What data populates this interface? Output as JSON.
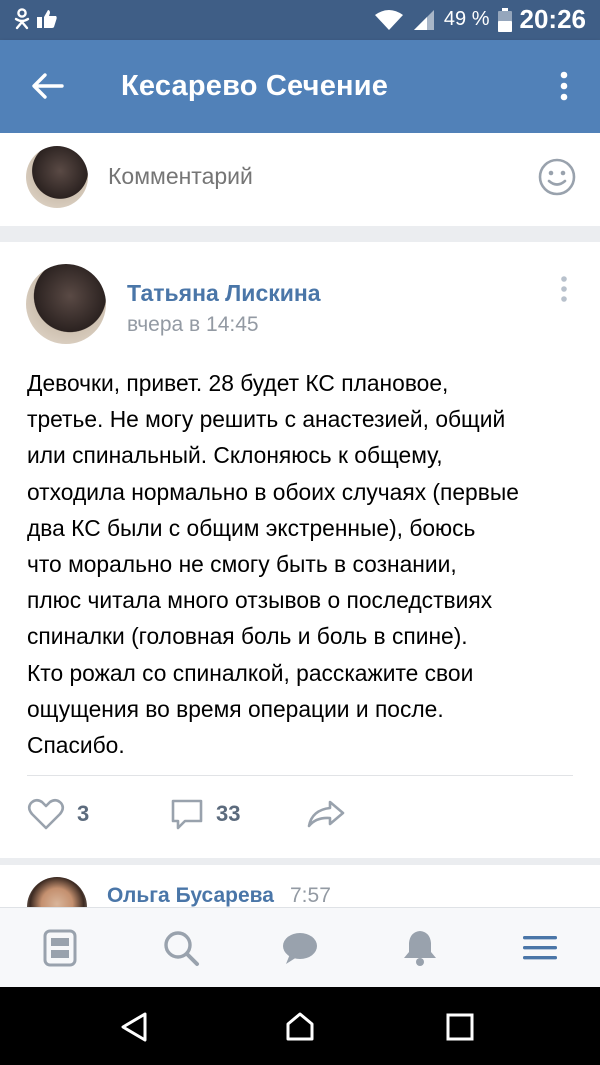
{
  "status_bar": {
    "left_icons": [
      "odnoklassniki-icon",
      "thumb-up-icon"
    ],
    "battery_percent": "49 %",
    "time": "20:26"
  },
  "app_bar": {
    "title": "Кесарево Сечение"
  },
  "comment_input": {
    "placeholder": "Комментарий"
  },
  "post": {
    "author": "Татьяна Лискина",
    "time": "вчера в 14:45",
    "text": "Девочки, привет. 28 будет КС плановое,\nтретье. Не могу решить с анастезией, общий\nили спинальный. Склоняюсь к общему,\nотходила нормально в обоих случаях (первые\nдва КС были с общим экстренные), боюсь\nчто морально не смогу быть в сознании,\nплюс читала много отзывов о последствиях\nспиналки (головная боль и боль в спине).\nКто рожал со спиналкой, расскажите свои\nощущения во время операции и после.\nСпасибо.",
    "likes": "3",
    "comments": "33"
  },
  "reply_preview": {
    "author": "Ольга Бусарева",
    "time": "7:57"
  },
  "bottom_tabs": [
    "news-icon",
    "search-icon",
    "messages-icon",
    "notifications-icon",
    "menu-icon"
  ],
  "system_nav": [
    "back-triangle-icon",
    "home-icon",
    "recents-square-icon"
  ],
  "colors": {
    "status_bar": "#3f5e86",
    "app_bar": "#5181b8",
    "link": "#4a76a8",
    "secondary_text": "#939aa3",
    "active_tab": "#4a76a8"
  }
}
